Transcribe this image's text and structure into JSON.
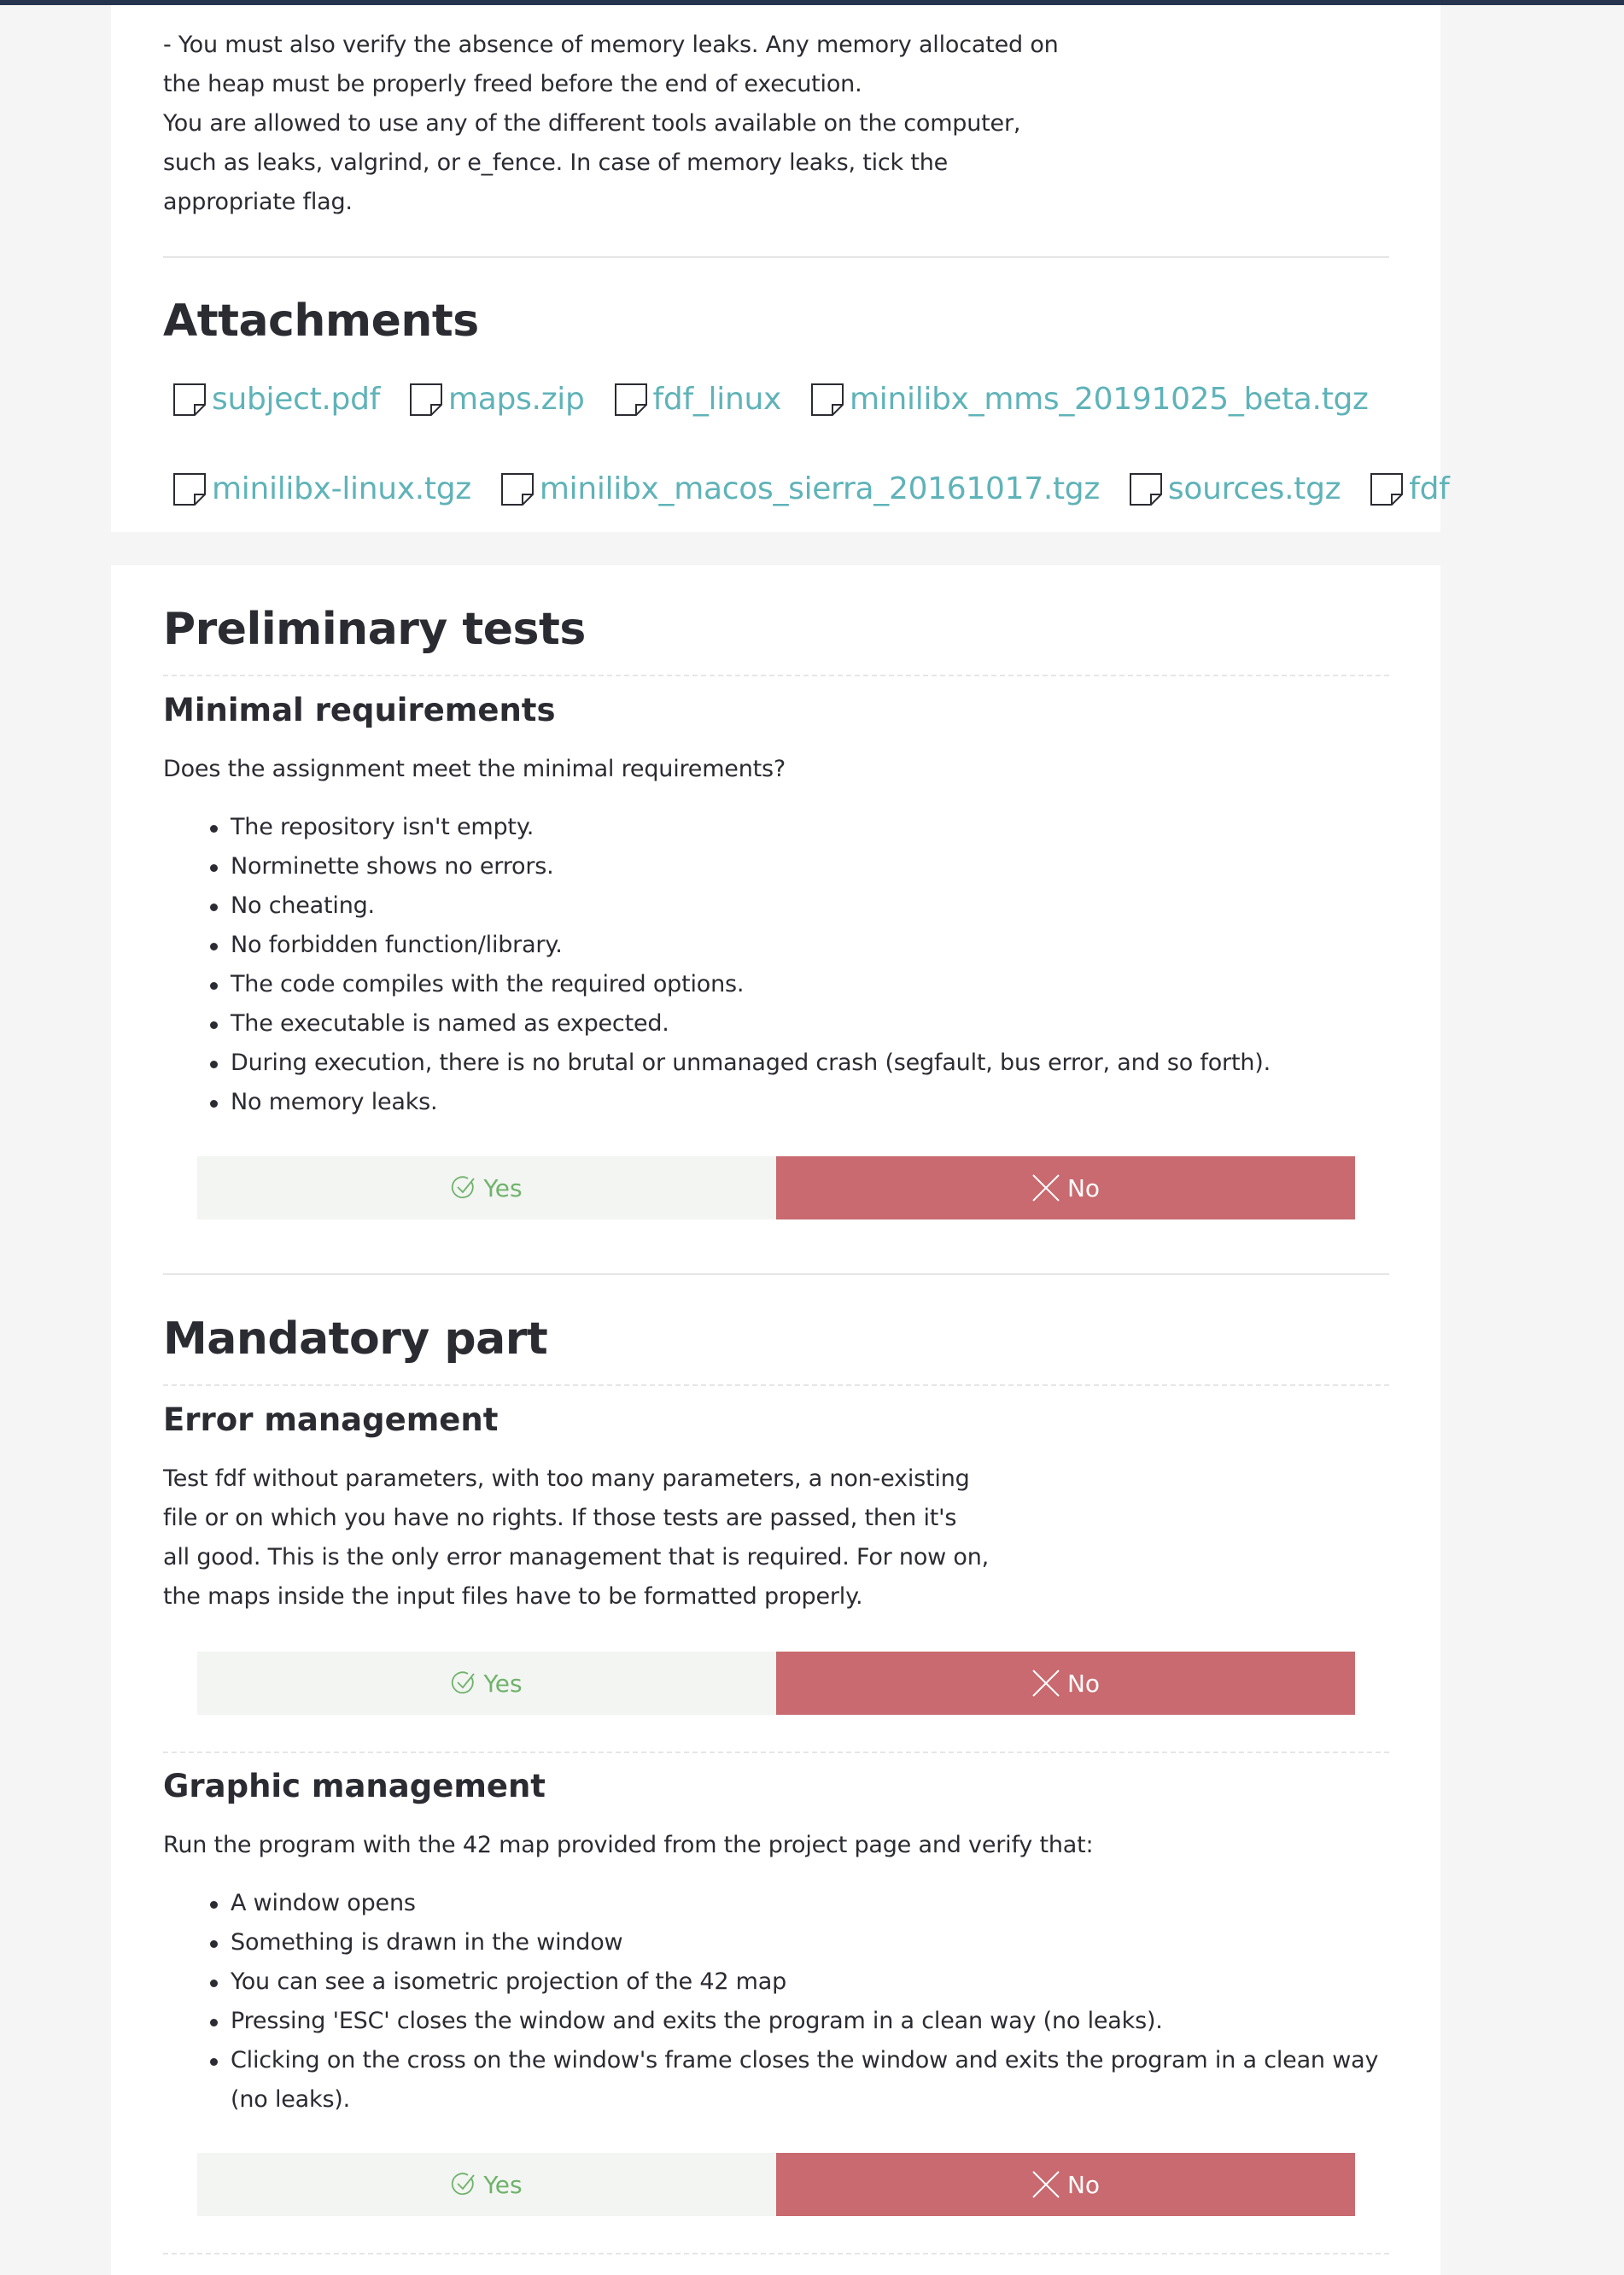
{
  "intro": {
    "lines": [
      "- You must also verify the absence of memory leaks. Any memory allocated on",
      "the heap must be properly freed before the end of execution.",
      "You are allowed to use any of the different tools available on the computer,",
      "such as leaks, valgrind, or e_fence. In case of memory leaks, tick the",
      "appropriate flag."
    ]
  },
  "attachments": {
    "title": "Attachments",
    "row1": [
      "subject.pdf",
      "maps.zip",
      "fdf_linux",
      "minilibx_mms_20191025_beta.tgz"
    ],
    "row2": [
      "minilibx-linux.tgz",
      "minilibx_macos_sierra_20161017.tgz",
      "sources.tgz",
      "fdf"
    ]
  },
  "preliminary": {
    "title": "Preliminary tests",
    "minimal": {
      "title": "Minimal requirements",
      "question": "Does the assignment meet the minimal requirements?",
      "items": [
        "The repository isn't empty.",
        "Norminette shows no errors.",
        "No cheating.",
        "No forbidden function/library.",
        "The code compiles with the required options.",
        "The executable is named as expected.",
        "During execution, there is no brutal or unmanaged crash (segfault, bus error, and so forth).",
        "No memory leaks."
      ]
    }
  },
  "mandatory": {
    "title": "Mandatory part",
    "error": {
      "title": "Error management",
      "lines": [
        "Test fdf without parameters, with too many parameters, a non-existing",
        "file or on which you have no rights. If those tests are passed, then it's",
        "all good. This is the only error management that is required. For now on,",
        "the maps inside the input files have to be formatted properly."
      ]
    },
    "graphic": {
      "title": "Graphic management",
      "intro": "Run the program with the 42 map provided from the project page and verify that:",
      "items": [
        "A window opens",
        "Something is drawn in the window",
        "You can see a isometric projection of the 42 map",
        "Pressing 'ESC' closes the window and exits the program in a clean way (no leaks).",
        "Clicking on the cross on the window's frame closes the window and exits the program in a clean way (no leaks)."
      ]
    }
  },
  "buttons": {
    "yes": "Yes",
    "no": "No"
  },
  "colors": {
    "link": "#5fb3b8",
    "yes": "#6fb36b",
    "no_bg": "#c86a6f",
    "topbar": "#26344e"
  },
  "icons": {
    "file": "file-icon",
    "yes": "check-circle-icon",
    "no": "cross-icon"
  }
}
